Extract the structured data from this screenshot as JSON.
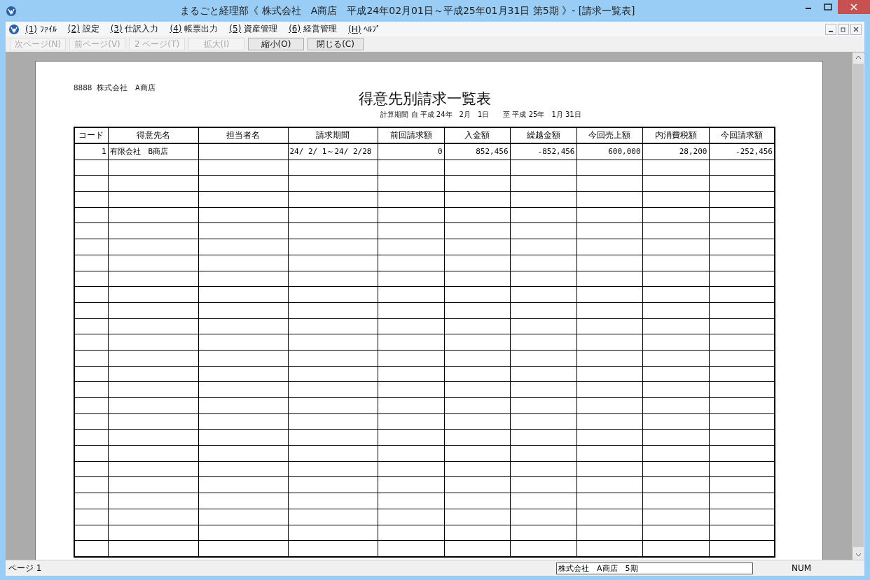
{
  "window": {
    "title": "まるごと経理部《 株式会社　A商店　平成24年02月01日～平成25年01月31日 第5期 》- [請求一覧表]"
  },
  "menu": [
    {
      "key": "(1)",
      "label": "ﾌｧｲﾙ"
    },
    {
      "key": "(2)",
      "label": "設定"
    },
    {
      "key": "(3)",
      "label": "仕訳入力"
    },
    {
      "key": "(4)",
      "label": "帳票出力"
    },
    {
      "key": "(5)",
      "label": "資産管理"
    },
    {
      "key": "(6)",
      "label": "経営管理"
    },
    {
      "key": "(H)",
      "label": "ﾍﾙﾌﾟ"
    }
  ],
  "toolbar": [
    {
      "label": "次ページ(N)",
      "disabled": true
    },
    {
      "label": "前ページ(V)",
      "disabled": true
    },
    {
      "label": "2 ページ(T)",
      "disabled": true
    },
    {
      "label": "拡大(I)",
      "disabled": true
    },
    {
      "label": "縮小(O)",
      "disabled": false
    },
    {
      "label": "閉じる(C)",
      "disabled": false
    }
  ],
  "report": {
    "company": "8888 株式会社　A商店",
    "title": "得意先別請求一覧表",
    "period": "計算期間 自 平成 24年　2月　1日　　至 平成 25年　1月 31日",
    "columns": [
      "コード",
      "得意先名",
      "担当者名",
      "請求期間",
      "前回請求額",
      "入金額",
      "繰越金額",
      "今回売上額",
      "内消費税額",
      "今回請求額"
    ],
    "rows": [
      [
        "1",
        "有限会社　B商店",
        "",
        "24/ 2/ 1～24/ 2/28",
        "0",
        "852,456",
        "-852,456",
        "600,000",
        "28,200",
        "-252,456"
      ]
    ]
  },
  "status_bar": {
    "page": "ページ 1",
    "company": "株式会社　A商店　5期",
    "num": "NUM"
  }
}
